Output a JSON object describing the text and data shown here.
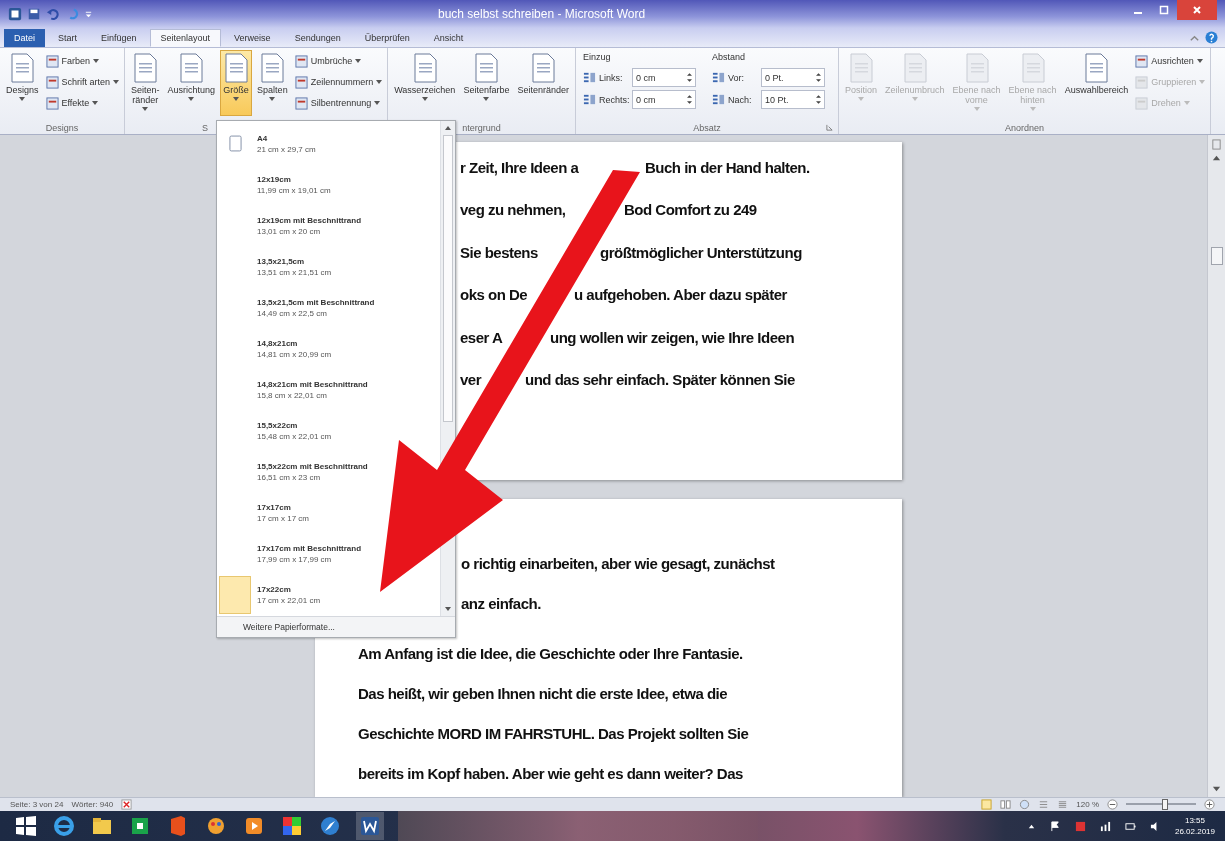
{
  "window": {
    "title": "buch selbst schreiben - Microsoft Word"
  },
  "tabs": [
    {
      "label": "Datei",
      "kind": "file",
      "selected": false
    },
    {
      "label": "Start",
      "kind": "tab",
      "selected": false
    },
    {
      "label": "Einfügen",
      "kind": "tab",
      "selected": false
    },
    {
      "label": "Seitenlayout",
      "kind": "tab",
      "selected": true
    },
    {
      "label": "Verweise",
      "kind": "tab",
      "selected": false
    },
    {
      "label": "Sendungen",
      "kind": "tab",
      "selected": false
    },
    {
      "label": "Überprüfen",
      "kind": "tab",
      "selected": false
    },
    {
      "label": "Ansicht",
      "kind": "tab",
      "selected": false
    }
  ],
  "ribbon": {
    "groups": [
      {
        "label": "Designs",
        "items": [
          {
            "kind": "large",
            "label": "Designs",
            "menu": true,
            "selected": false,
            "disabled": false
          },
          {
            "kind": "small",
            "label": "Farben",
            "menu": true,
            "selected": false,
            "disabled": false
          },
          {
            "kind": "small",
            "label": "Schrift arten",
            "menu": true,
            "selected": false,
            "disabled": false
          },
          {
            "kind": "small",
            "label": "Effekte",
            "menu": true,
            "selected": false,
            "disabled": false
          }
        ]
      },
      {
        "label": "S",
        "items": [
          {
            "kind": "large",
            "label": "Seiten-\nränder",
            "menu": true,
            "selected": false,
            "disabled": false
          },
          {
            "kind": "large",
            "label": "Ausrichtung",
            "menu": true,
            "selected": false,
            "disabled": false
          },
          {
            "kind": "large",
            "label": "Größe",
            "menu": true,
            "selected": true,
            "disabled": false
          },
          {
            "kind": "large",
            "label": "Spalten",
            "menu": true,
            "selected": false,
            "disabled": false
          },
          {
            "kind": "small",
            "label": "Umbrüche",
            "menu": true,
            "selected": false,
            "disabled": false
          },
          {
            "kind": "small",
            "label": "Zeilennummern",
            "menu": true,
            "selected": false,
            "disabled": false
          },
          {
            "kind": "small",
            "label": "Silbentrennung",
            "menu": true,
            "selected": false,
            "disabled": false
          }
        ]
      },
      {
        "label": "ntergrund",
        "items": [
          {
            "kind": "large",
            "label": "Wasserzeichen",
            "menu": true,
            "selected": false,
            "disabled": false
          },
          {
            "kind": "large",
            "label": "Seitenfarbe",
            "menu": true,
            "selected": false,
            "disabled": false
          },
          {
            "kind": "large",
            "label": "Seitenränder",
            "menu": false,
            "selected": false,
            "disabled": false
          }
        ]
      },
      {
        "label": "Absatz",
        "items": [
          {
            "kind": "spin",
            "heading": "Einzug",
            "rows": [
              {
                "label": "Links:",
                "value": "0 cm"
              },
              {
                "label": "Rechts:",
                "value": "0 cm"
              }
            ]
          },
          {
            "kind": "spin",
            "heading": "Abstand",
            "rows": [
              {
                "label": "Vor:",
                "value": "0 Pt."
              },
              {
                "label": "Nach:",
                "value": "10 Pt."
              }
            ]
          }
        ]
      },
      {
        "label": "Anordnen",
        "items": [
          {
            "kind": "large",
            "label": "Position",
            "menu": true,
            "selected": false,
            "disabled": true
          },
          {
            "kind": "large",
            "label": "Zeilenumbruch",
            "menu": true,
            "selected": false,
            "disabled": true
          },
          {
            "kind": "large",
            "label": "Ebene nach\nvorne",
            "menu": true,
            "selected": false,
            "disabled": true
          },
          {
            "kind": "large",
            "label": "Ebene nach\nhinten",
            "menu": true,
            "selected": false,
            "disabled": true
          },
          {
            "kind": "large",
            "label": "Auswahlbereich",
            "menu": false,
            "selected": false,
            "disabled": false
          },
          {
            "kind": "small",
            "label": "Ausrichten",
            "menu": true,
            "selected": false,
            "disabled": false
          },
          {
            "kind": "small",
            "label": "Gruppieren",
            "menu": true,
            "selected": false,
            "disabled": true
          },
          {
            "kind": "small",
            "label": "Drehen",
            "menu": true,
            "selected": false,
            "disabled": true
          }
        ]
      }
    ]
  },
  "size_menu": {
    "items": [
      {
        "name": "A4",
        "size": "21 cm x 29,7 cm",
        "icon": true,
        "selected": false
      },
      {
        "name": "12x19cm",
        "size": "11,99 cm x 19,01 cm",
        "icon": false,
        "selected": false
      },
      {
        "name": "12x19cm mit Beschnittrand",
        "size": "13,01 cm x 20 cm",
        "icon": false,
        "selected": false
      },
      {
        "name": "13,5x21,5cm",
        "size": "13,51 cm x 21,51 cm",
        "icon": false,
        "selected": false
      },
      {
        "name": "13,5x21,5cm mit Beschnittrand",
        "size": "14,49 cm x 22,5 cm",
        "icon": false,
        "selected": false
      },
      {
        "name": "14,8x21cm",
        "size": "14,81 cm x 20,99 cm",
        "icon": false,
        "selected": false
      },
      {
        "name": "14,8x21cm mit Beschnittrand",
        "size": "15,8 cm x 22,01 cm",
        "icon": false,
        "selected": false
      },
      {
        "name": "15,5x22cm",
        "size": "15,48 cm x 22,01 cm",
        "icon": false,
        "selected": false
      },
      {
        "name": "15,5x22cm mit Beschnittrand",
        "size": "16,51 cm x 23 cm",
        "icon": false,
        "selected": false
      },
      {
        "name": "17x17cm",
        "size": "17 cm x 17 cm",
        "icon": false,
        "selected": false
      },
      {
        "name": "17x17cm mit Beschnittrand",
        "size": "17,99 cm x 17,99 cm",
        "icon": false,
        "selected": false
      },
      {
        "name": "17x22cm",
        "size": "17 cm x 22,01 cm",
        "icon": false,
        "selected": true
      }
    ],
    "footer": "Weitere Papierformate..."
  },
  "pages": [
    {
      "paragraphs": [
        {
          "lines": [
            {
              "kind": "split",
              "parts": [
                "r Zeit, Ihre Ideen a",
                "Buch in der Hand halten."
              ]
            },
            {
              "kind": "split",
              "parts": [
                "veg zu nehmen,",
                "Bod Comfort zu 249"
              ]
            },
            {
              "kind": "split",
              "parts": [
                "Sie bestens",
                "größtmöglicher Unterstützung"
              ]
            },
            {
              "kind": "split",
              "parts": [
                "oks on De",
                "u aufgehoben. Aber dazu später"
              ]
            },
            {
              "kind": "split",
              "parts": [
                "eser A",
                "ung wollen wir zeigen, wie Ihre Ideen"
              ]
            },
            {
              "kind": "split",
              "parts": [
                "ver",
                "und das sehr einfach. Später können Sie"
              ]
            }
          ]
        }
      ]
    },
    {
      "paragraphs": [
        {
          "lines": [
            {
              "kind": "cut",
              "parts": [
                "o richtig einarbeiten, aber wie gesagt, zunächst"
              ]
            },
            {
              "kind": "cut",
              "parts": [
                "anz einfach."
              ]
            }
          ]
        },
        {
          "lines": [
            {
              "kind": "full",
              "parts": [
                "Am Anfang ist die Idee, die Geschichte oder Ihre Fantasie."
              ]
            },
            {
              "kind": "full",
              "parts": [
                "Das heißt, wir geben Ihnen nicht die erste Idee, etwa die"
              ]
            },
            {
              "kind": "full",
              "parts": [
                "Geschichte MORD IM FAHRSTUHL. Das Projekt sollten Sie"
              ]
            },
            {
              "kind": "full",
              "parts": [
                "bereits im Kopf haben. Aber wie geht es dann weiter? Das"
              ]
            }
          ]
        }
      ]
    }
  ],
  "status_bar": {
    "page": "Seite: 3 von 24",
    "words": "Wörter: 940",
    "zoom": "120 %",
    "zoom_slider": {
      "level": 0.55
    }
  },
  "taskbar": {
    "time": "13:55",
    "date": "26.02.2019"
  }
}
